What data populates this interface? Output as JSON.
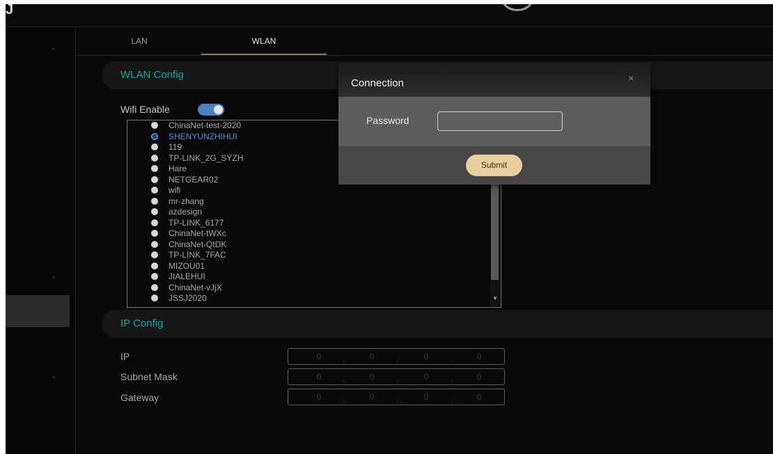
{
  "header": {
    "logo_text": "J"
  },
  "tabs": [
    {
      "label": "LAN"
    },
    {
      "label": "WLAN"
    }
  ],
  "wlan_config": {
    "title": "WLAN Config",
    "wifi_enable_label": "Wifi Enable",
    "wifi_enabled": true,
    "networks": [
      "ChinaNet-test-2020",
      "SHENYUNZHIHUI",
      "119",
      "TP-LINK_2G_SYZH",
      "Hare",
      "NETGEAR02",
      "wifi",
      "mr-zhang",
      "azdesign",
      "TP-LINK_6177",
      "ChinaNet-tWXc",
      "ChinaNet-QtDK",
      "TP-LINK_7FAC",
      "MIZOU01",
      "JIALEHUI",
      "ChinaNet-vJjX",
      "JSSJ2020"
    ],
    "selected_network": "SHENYUNZHIHUI"
  },
  "ip_config": {
    "title": "IP Config",
    "fields": [
      {
        "label": "IP",
        "octets": [
          "0",
          "0",
          "0",
          "0"
        ]
      },
      {
        "label": "Subnet Mask",
        "octets": [
          "0",
          "0",
          "0",
          "0"
        ]
      },
      {
        "label": "Gateway",
        "octets": [
          "0",
          "0",
          "0",
          "0"
        ]
      }
    ],
    "separator": "."
  },
  "modal": {
    "title": "Connection",
    "close_symbol": "×",
    "password_label": "Password",
    "password_value": "",
    "submit_label": "Submit"
  },
  "icons": {
    "chevron_up": "⌃",
    "chevron_down": "⌄",
    "scroll_down": "▼"
  },
  "colors": {
    "accent_teal": "#16a9a1",
    "toggle_blue": "#4a7fc0",
    "selected_blue": "#4a8fe0",
    "submit_gold": "#e9cf9e"
  }
}
